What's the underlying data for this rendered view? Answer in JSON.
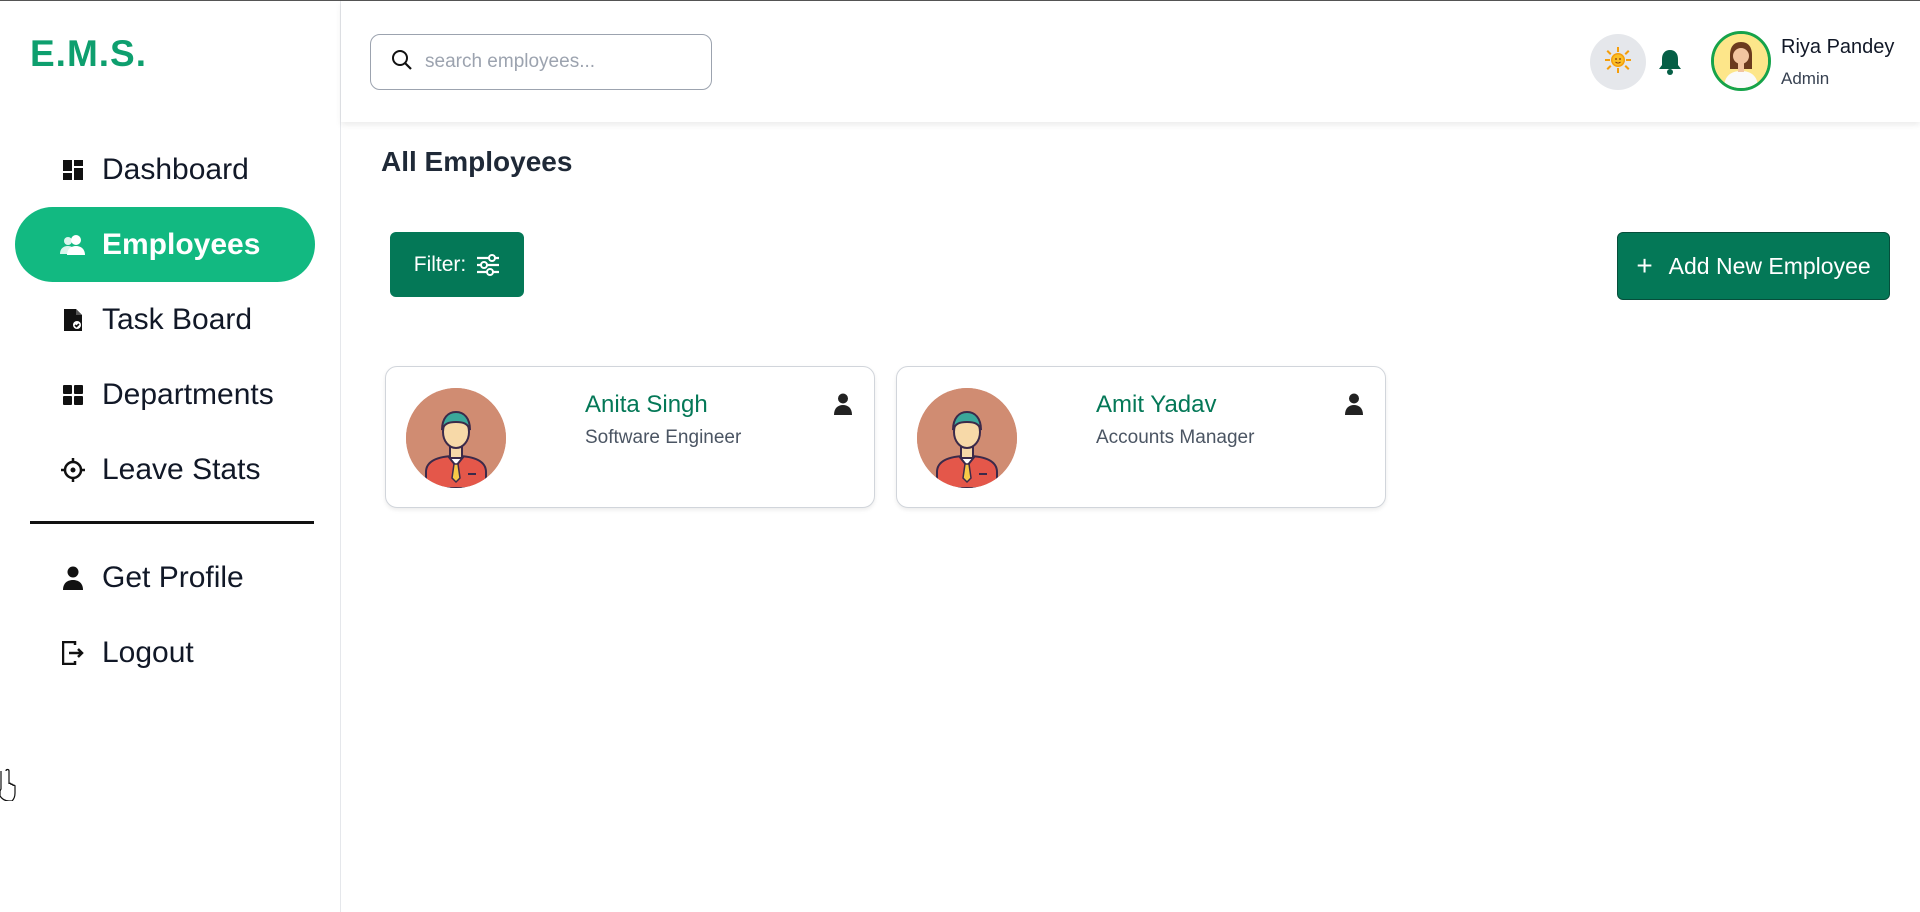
{
  "app": {
    "logo": "E.M.S."
  },
  "sidebar": {
    "items": [
      {
        "label": "Dashboard",
        "icon": "dashboard-icon"
      },
      {
        "label": "Employees",
        "icon": "users-icon",
        "active": true
      },
      {
        "label": "Task Board",
        "icon": "task-icon"
      },
      {
        "label": "Departments",
        "icon": "grid-icon"
      },
      {
        "label": "Leave Stats",
        "icon": "crosshair-icon"
      }
    ],
    "secondary": [
      {
        "label": "Get Profile",
        "icon": "user-icon"
      },
      {
        "label": "Logout",
        "icon": "logout-icon"
      }
    ]
  },
  "header": {
    "search_placeholder": "search employees...",
    "user": {
      "name": "Riya Pandey",
      "role": "Admin"
    }
  },
  "main": {
    "title": "All Employees",
    "filter_label": "Filter:",
    "add_label": "Add New Employee",
    "employees": [
      {
        "name": "Anita Singh",
        "role": "Software Engineer"
      },
      {
        "name": "Amit Yadav",
        "role": "Accounts Manager"
      }
    ]
  },
  "colors": {
    "accent": "#12b981",
    "primary_dark": "#047857",
    "logo": "#0e9f6e"
  }
}
